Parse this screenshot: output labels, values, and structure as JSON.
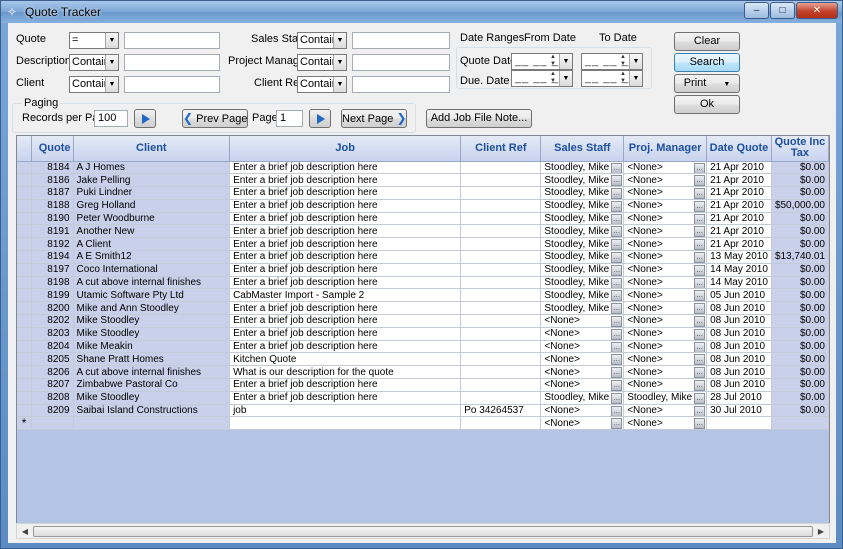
{
  "window": {
    "title": "Quote Tracker",
    "minimize": "–",
    "maximize": "□",
    "close": "✕"
  },
  "filters": {
    "quote_label": "Quote",
    "quote_op": "=",
    "quote_value": "",
    "description_label": "Description",
    "description_op": "Contains",
    "description_value": "",
    "client_label": "Client",
    "client_op": "Contains",
    "client_value": "",
    "sales_staff_label": "Sales Staff",
    "sales_staff_op": "Contains",
    "sales_staff_value": "",
    "project_manager_label": "Project Manager",
    "project_manager_op": "Contains",
    "project_manager_value": "",
    "client_ref_label": "Client Ref",
    "client_ref_op": "Contains",
    "client_ref_value": ""
  },
  "dates": {
    "title": "Date Ranges",
    "from_label": "From Date",
    "to_label": "To Date",
    "quote_date_label": "Quote Date",
    "due_date_label": "Due. Date",
    "blank": "__ __ __"
  },
  "buttons": {
    "clear": "Clear",
    "search": "Search",
    "print": "Print",
    "ok": "Ok",
    "add_note": "Add Job File Note..."
  },
  "paging": {
    "title": "Paging",
    "records_label": "Records per Page",
    "records_value": "100",
    "prev": "Prev Page",
    "page_label": "Page",
    "page_value": "1",
    "next": "Next Page"
  },
  "grid": {
    "columns": [
      "Quote",
      "Client",
      "Job",
      "Client Ref",
      "Sales Staff",
      "Proj. Manager",
      "Date Quote",
      "Quote Inc Tax"
    ],
    "rows": [
      [
        "8184",
        "A J Homes",
        "Enter a brief job description here",
        "",
        "Stoodley, Mike",
        "<None>",
        "21 Apr 2010",
        "$0.00"
      ],
      [
        "8186",
        "Jake Pelling",
        "Enter a brief job description here",
        "",
        "Stoodley, Mike",
        "<None>",
        "21 Apr 2010",
        "$0.00"
      ],
      [
        "8187",
        "Puki Lindner",
        "Enter a brief job description here",
        "",
        "Stoodley, Mike",
        "<None>",
        "21 Apr 2010",
        "$0.00"
      ],
      [
        "8188",
        "Greg Holland",
        "Enter a brief job description here",
        "",
        "Stoodley, Mike",
        "<None>",
        "21 Apr 2010",
        "$50,000.00"
      ],
      [
        "8190",
        "Peter Woodburne",
        "Enter a brief job description here",
        "",
        "Stoodley, Mike",
        "<None>",
        "21 Apr 2010",
        "$0.00"
      ],
      [
        "8191",
        "Another New",
        "Enter a brief job description here",
        "",
        "Stoodley, Mike",
        "<None>",
        "21 Apr 2010",
        "$0.00"
      ],
      [
        "8192",
        "A Client",
        "Enter a brief job description here",
        "",
        "Stoodley, Mike",
        "<None>",
        "21 Apr 2010",
        "$0.00"
      ],
      [
        "8194",
        "A E Smith12",
        "Enter a brief job description here",
        "",
        "Stoodley, Mike",
        "<None>",
        "13 May 2010",
        "$13,740.01"
      ],
      [
        "8197",
        "Coco International",
        "Enter a brief job description here",
        "",
        "Stoodley, Mike",
        "<None>",
        "14 May 2010",
        "$0.00"
      ],
      [
        "8198",
        "A cut above internal finishes",
        "Enter a brief job description here",
        "",
        "Stoodley, Mike",
        "<None>",
        "14 May 2010",
        "$0.00"
      ],
      [
        "8199",
        "Utamic Software Pty Ltd",
        "CabMaster Import - Sample 2",
        "",
        "Stoodley, Mike",
        "<None>",
        "05 Jun 2010",
        "$0.00"
      ],
      [
        "8200",
        "Mike and Ann Stoodley",
        "Enter a brief job description here",
        "",
        "Stoodley, Mike",
        "<None>",
        "08 Jun 2010",
        "$0.00"
      ],
      [
        "8202",
        "Mike Stoodley",
        "Enter a brief job description here",
        "",
        "<None>",
        "<None>",
        "08 Jun 2010",
        "$0.00"
      ],
      [
        "8203",
        "Mike Stoodley",
        "Enter a brief job description here",
        "",
        "<None>",
        "<None>",
        "08 Jun 2010",
        "$0.00"
      ],
      [
        "8204",
        "Mike Meakin",
        "Enter a brief job description here",
        "",
        "<None>",
        "<None>",
        "08 Jun 2010",
        "$0.00"
      ],
      [
        "8205",
        "Shane Pratt Homes",
        "Kitchen Quote",
        "",
        "<None>",
        "<None>",
        "08 Jun 2010",
        "$0.00"
      ],
      [
        "8206",
        "A cut above internal finishes",
        "What is our description for the quote",
        "",
        "<None>",
        "<None>",
        "08 Jun 2010",
        "$0.00"
      ],
      [
        "8207",
        "Zimbabwe Pastoral Co",
        "Enter a brief job description here",
        "",
        "<None>",
        "<None>",
        "08 Jun 2010",
        "$0.00"
      ],
      [
        "8208",
        "Mike Stoodley",
        "Enter a brief job description here",
        "",
        "Stoodley, Mike",
        "Stoodley, Mike",
        "28 Jul 2010",
        "$0.00"
      ],
      [
        "8209",
        "Saibai Island Constructions",
        "job",
        "Po 34264537",
        "<None>",
        "<None>",
        "30 Jul 2010",
        "$0.00"
      ]
    ],
    "new_row": {
      "marker": "*",
      "sales_staff": "<None>",
      "proj_manager": "<None>"
    }
  }
}
